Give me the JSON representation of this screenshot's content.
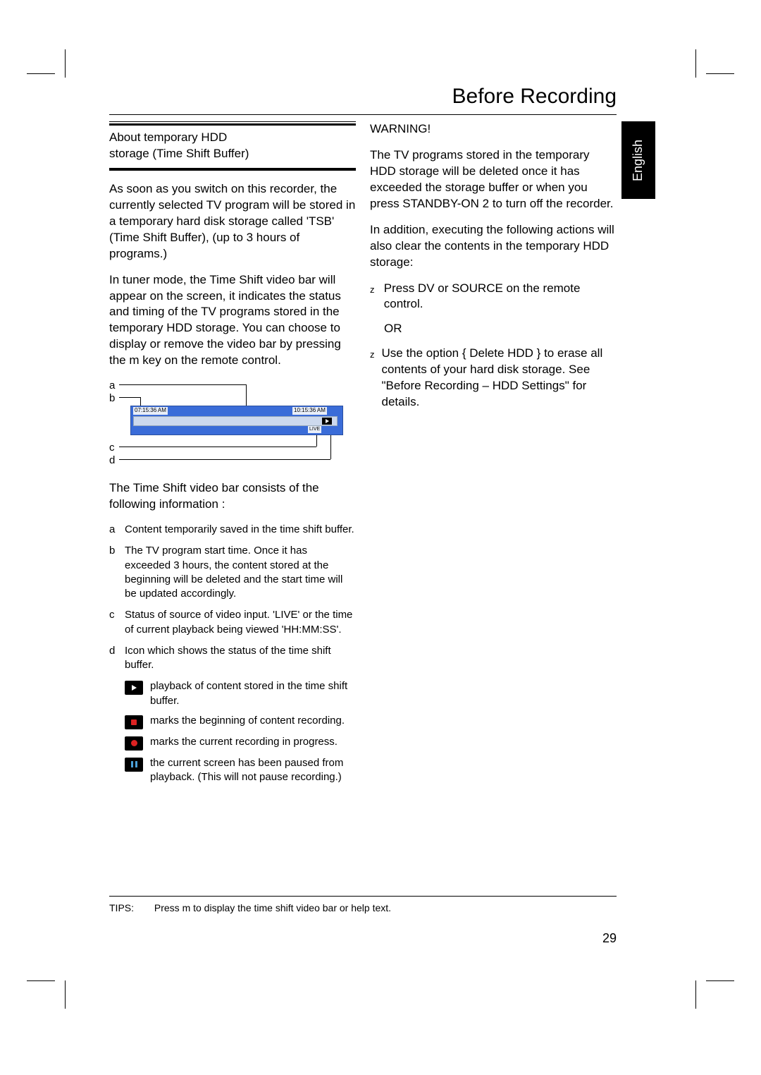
{
  "chapterTitle": "Before Recording",
  "langTab": "English",
  "pageNumber": "29",
  "left": {
    "heading1": "About temporary HDD",
    "heading2": "storage (Time Shift Buffer)",
    "para1": "As soon as you switch on this recorder, the currently selected TV program will be stored in a temporary hard disk storage called 'TSB' (Time Shift Buffer), (up to 3 hours of programs.)",
    "para2": "In tuner mode, the Time Shift video bar will appear on the screen, it indicates the status and timing of the TV programs stored in the temporary HDD storage. You can choose to display or remove the video bar by pressing the m key on the remote control.",
    "diagram": {
      "a": "a",
      "b": "b",
      "c": "c",
      "d": "d",
      "startTime": "07:15:36 AM",
      "endTime": "10:15:36 AM",
      "live": "LIVE"
    },
    "para3": "The Time Shift video bar consists of the following information :",
    "items": {
      "a": "Content temporarily saved in the time shift buffer.",
      "b": "The TV program start time. Once it has exceeded 3 hours, the content stored at the beginning will be deleted and the start time will be updated accordingly.",
      "c": "Status of source of video input. 'LIVE' or the time of current playback being viewed 'HH:MM:SS'.",
      "d": "Icon which shows the status of the time shift buffer.",
      "dsub": {
        "play": "playback of content stored in the time shift buffer.",
        "recstart": "marks the beginning of content recording.",
        "recnow": "marks the current recording in progress.",
        "pause": "the current screen has been paused from playback. (This will not pause recording.)"
      }
    }
  },
  "right": {
    "warningHead": "WARNING!",
    "warning1": "The TV programs stored in the temporary HDD storage will be deleted once it has exceeded the storage buffer or when you press STANDBY-ON 2 to turn off the recorder.",
    "warning2": "In addition, executing the following actions will also clear the contents in the temporary HDD storage:",
    "z1": "Press DV or SOURCE on the remote control.",
    "or": "OR",
    "z2": "Use the option { Delete HDD } to erase all contents of your hard disk storage. See \"Before Recording – HDD Settings\" for details."
  },
  "tips": {
    "label": "TIPS:",
    "text": "Press m to display the time shift video bar or help text."
  }
}
